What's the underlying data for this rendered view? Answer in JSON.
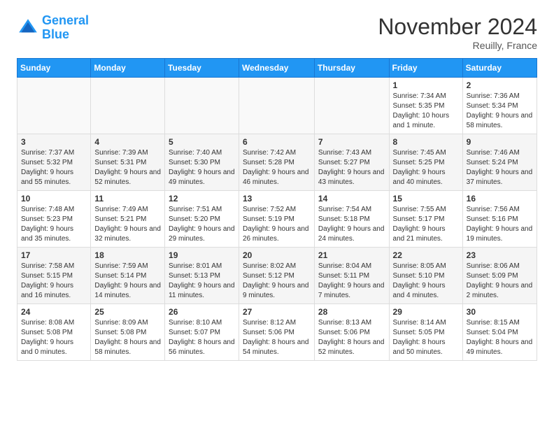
{
  "header": {
    "logo_line1": "General",
    "logo_line2": "Blue",
    "month": "November 2024",
    "location": "Reuilly, France"
  },
  "weekdays": [
    "Sunday",
    "Monday",
    "Tuesday",
    "Wednesday",
    "Thursday",
    "Friday",
    "Saturday"
  ],
  "weeks": [
    [
      {
        "day": "",
        "info": ""
      },
      {
        "day": "",
        "info": ""
      },
      {
        "day": "",
        "info": ""
      },
      {
        "day": "",
        "info": ""
      },
      {
        "day": "",
        "info": ""
      },
      {
        "day": "1",
        "info": "Sunrise: 7:34 AM\nSunset: 5:35 PM\nDaylight: 10 hours and 1 minute."
      },
      {
        "day": "2",
        "info": "Sunrise: 7:36 AM\nSunset: 5:34 PM\nDaylight: 9 hours and 58 minutes."
      }
    ],
    [
      {
        "day": "3",
        "info": "Sunrise: 7:37 AM\nSunset: 5:32 PM\nDaylight: 9 hours and 55 minutes."
      },
      {
        "day": "4",
        "info": "Sunrise: 7:39 AM\nSunset: 5:31 PM\nDaylight: 9 hours and 52 minutes."
      },
      {
        "day": "5",
        "info": "Sunrise: 7:40 AM\nSunset: 5:30 PM\nDaylight: 9 hours and 49 minutes."
      },
      {
        "day": "6",
        "info": "Sunrise: 7:42 AM\nSunset: 5:28 PM\nDaylight: 9 hours and 46 minutes."
      },
      {
        "day": "7",
        "info": "Sunrise: 7:43 AM\nSunset: 5:27 PM\nDaylight: 9 hours and 43 minutes."
      },
      {
        "day": "8",
        "info": "Sunrise: 7:45 AM\nSunset: 5:25 PM\nDaylight: 9 hours and 40 minutes."
      },
      {
        "day": "9",
        "info": "Sunrise: 7:46 AM\nSunset: 5:24 PM\nDaylight: 9 hours and 37 minutes."
      }
    ],
    [
      {
        "day": "10",
        "info": "Sunrise: 7:48 AM\nSunset: 5:23 PM\nDaylight: 9 hours and 35 minutes."
      },
      {
        "day": "11",
        "info": "Sunrise: 7:49 AM\nSunset: 5:21 PM\nDaylight: 9 hours and 32 minutes."
      },
      {
        "day": "12",
        "info": "Sunrise: 7:51 AM\nSunset: 5:20 PM\nDaylight: 9 hours and 29 minutes."
      },
      {
        "day": "13",
        "info": "Sunrise: 7:52 AM\nSunset: 5:19 PM\nDaylight: 9 hours and 26 minutes."
      },
      {
        "day": "14",
        "info": "Sunrise: 7:54 AM\nSunset: 5:18 PM\nDaylight: 9 hours and 24 minutes."
      },
      {
        "day": "15",
        "info": "Sunrise: 7:55 AM\nSunset: 5:17 PM\nDaylight: 9 hours and 21 minutes."
      },
      {
        "day": "16",
        "info": "Sunrise: 7:56 AM\nSunset: 5:16 PM\nDaylight: 9 hours and 19 minutes."
      }
    ],
    [
      {
        "day": "17",
        "info": "Sunrise: 7:58 AM\nSunset: 5:15 PM\nDaylight: 9 hours and 16 minutes."
      },
      {
        "day": "18",
        "info": "Sunrise: 7:59 AM\nSunset: 5:14 PM\nDaylight: 9 hours and 14 minutes."
      },
      {
        "day": "19",
        "info": "Sunrise: 8:01 AM\nSunset: 5:13 PM\nDaylight: 9 hours and 11 minutes."
      },
      {
        "day": "20",
        "info": "Sunrise: 8:02 AM\nSunset: 5:12 PM\nDaylight: 9 hours and 9 minutes."
      },
      {
        "day": "21",
        "info": "Sunrise: 8:04 AM\nSunset: 5:11 PM\nDaylight: 9 hours and 7 minutes."
      },
      {
        "day": "22",
        "info": "Sunrise: 8:05 AM\nSunset: 5:10 PM\nDaylight: 9 hours and 4 minutes."
      },
      {
        "day": "23",
        "info": "Sunrise: 8:06 AM\nSunset: 5:09 PM\nDaylight: 9 hours and 2 minutes."
      }
    ],
    [
      {
        "day": "24",
        "info": "Sunrise: 8:08 AM\nSunset: 5:08 PM\nDaylight: 9 hours and 0 minutes."
      },
      {
        "day": "25",
        "info": "Sunrise: 8:09 AM\nSunset: 5:08 PM\nDaylight: 8 hours and 58 minutes."
      },
      {
        "day": "26",
        "info": "Sunrise: 8:10 AM\nSunset: 5:07 PM\nDaylight: 8 hours and 56 minutes."
      },
      {
        "day": "27",
        "info": "Sunrise: 8:12 AM\nSunset: 5:06 PM\nDaylight: 8 hours and 54 minutes."
      },
      {
        "day": "28",
        "info": "Sunrise: 8:13 AM\nSunset: 5:06 PM\nDaylight: 8 hours and 52 minutes."
      },
      {
        "day": "29",
        "info": "Sunrise: 8:14 AM\nSunset: 5:05 PM\nDaylight: 8 hours and 50 minutes."
      },
      {
        "day": "30",
        "info": "Sunrise: 8:15 AM\nSunset: 5:04 PM\nDaylight: 8 hours and 49 minutes."
      }
    ]
  ]
}
